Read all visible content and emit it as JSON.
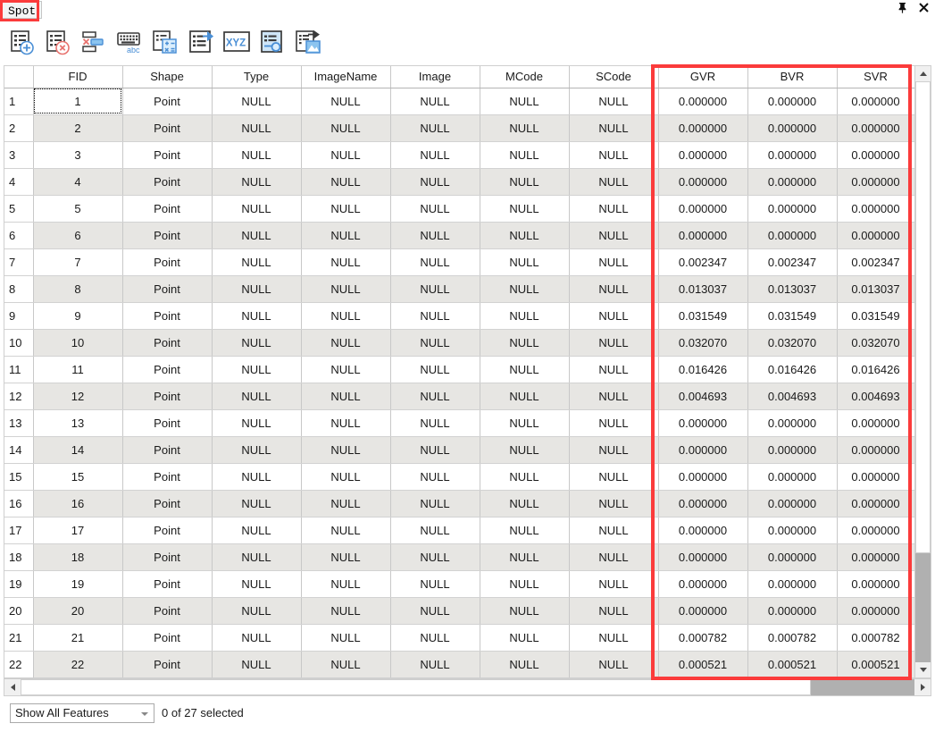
{
  "window": {
    "tab_label": "Spot",
    "pin_icon": "pin-icon",
    "close_icon": "close-icon",
    "pin_glyph": "丩",
    "close_glyph": "✕"
  },
  "toolbar": {
    "buttons": [
      {
        "name": "add-field-button",
        "tooltip": "Add Field"
      },
      {
        "name": "delete-field-button",
        "tooltip": "Delete Field"
      },
      {
        "name": "delete-selection-button",
        "tooltip": "Delete Selected Records"
      },
      {
        "name": "field-alias-button",
        "tooltip": "Field Alias"
      },
      {
        "name": "field-calculator-button",
        "tooltip": "Field Calculator"
      },
      {
        "name": "export-table-button",
        "tooltip": "Export Table"
      },
      {
        "name": "xyz-button",
        "tooltip": "XYZ"
      },
      {
        "name": "attribute-query-button",
        "tooltip": "Attribute Query"
      },
      {
        "name": "export-image-button",
        "tooltip": "Export Image"
      }
    ],
    "xyz_label": "XYZ",
    "abc_label": "abc"
  },
  "table": {
    "columns": [
      {
        "key": "rownum",
        "label": ""
      },
      {
        "key": "FID",
        "label": "FID"
      },
      {
        "key": "Shape",
        "label": "Shape"
      },
      {
        "key": "Type",
        "label": "Type"
      },
      {
        "key": "ImageName",
        "label": "ImageName"
      },
      {
        "key": "Image",
        "label": "Image"
      },
      {
        "key": "MCode",
        "label": "MCode"
      },
      {
        "key": "SCode",
        "label": "SCode"
      },
      {
        "key": "GVR",
        "label": "GVR"
      },
      {
        "key": "BVR",
        "label": "BVR"
      },
      {
        "key": "SVR",
        "label": "SVR"
      }
    ],
    "highlighted_columns": [
      "GVR",
      "BVR",
      "SVR"
    ],
    "highlight_color": "#fb3b3b",
    "focused_cell": {
      "row": 1,
      "column": "FID"
    },
    "rows": [
      {
        "rownum": "1",
        "FID": "1",
        "Shape": "Point",
        "Type": "NULL",
        "ImageName": "NULL",
        "Image": "NULL",
        "MCode": "NULL",
        "SCode": "NULL",
        "GVR": "0.000000",
        "BVR": "0.000000",
        "SVR": "0.000000"
      },
      {
        "rownum": "2",
        "FID": "2",
        "Shape": "Point",
        "Type": "NULL",
        "ImageName": "NULL",
        "Image": "NULL",
        "MCode": "NULL",
        "SCode": "NULL",
        "GVR": "0.000000",
        "BVR": "0.000000",
        "SVR": "0.000000"
      },
      {
        "rownum": "3",
        "FID": "3",
        "Shape": "Point",
        "Type": "NULL",
        "ImageName": "NULL",
        "Image": "NULL",
        "MCode": "NULL",
        "SCode": "NULL",
        "GVR": "0.000000",
        "BVR": "0.000000",
        "SVR": "0.000000"
      },
      {
        "rownum": "4",
        "FID": "4",
        "Shape": "Point",
        "Type": "NULL",
        "ImageName": "NULL",
        "Image": "NULL",
        "MCode": "NULL",
        "SCode": "NULL",
        "GVR": "0.000000",
        "BVR": "0.000000",
        "SVR": "0.000000"
      },
      {
        "rownum": "5",
        "FID": "5",
        "Shape": "Point",
        "Type": "NULL",
        "ImageName": "NULL",
        "Image": "NULL",
        "MCode": "NULL",
        "SCode": "NULL",
        "GVR": "0.000000",
        "BVR": "0.000000",
        "SVR": "0.000000"
      },
      {
        "rownum": "6",
        "FID": "6",
        "Shape": "Point",
        "Type": "NULL",
        "ImageName": "NULL",
        "Image": "NULL",
        "MCode": "NULL",
        "SCode": "NULL",
        "GVR": "0.000000",
        "BVR": "0.000000",
        "SVR": "0.000000"
      },
      {
        "rownum": "7",
        "FID": "7",
        "Shape": "Point",
        "Type": "NULL",
        "ImageName": "NULL",
        "Image": "NULL",
        "MCode": "NULL",
        "SCode": "NULL",
        "GVR": "0.002347",
        "BVR": "0.002347",
        "SVR": "0.002347"
      },
      {
        "rownum": "8",
        "FID": "8",
        "Shape": "Point",
        "Type": "NULL",
        "ImageName": "NULL",
        "Image": "NULL",
        "MCode": "NULL",
        "SCode": "NULL",
        "GVR": "0.013037",
        "BVR": "0.013037",
        "SVR": "0.013037"
      },
      {
        "rownum": "9",
        "FID": "9",
        "Shape": "Point",
        "Type": "NULL",
        "ImageName": "NULL",
        "Image": "NULL",
        "MCode": "NULL",
        "SCode": "NULL",
        "GVR": "0.031549",
        "BVR": "0.031549",
        "SVR": "0.031549"
      },
      {
        "rownum": "10",
        "FID": "10",
        "Shape": "Point",
        "Type": "NULL",
        "ImageName": "NULL",
        "Image": "NULL",
        "MCode": "NULL",
        "SCode": "NULL",
        "GVR": "0.032070",
        "BVR": "0.032070",
        "SVR": "0.032070"
      },
      {
        "rownum": "11",
        "FID": "11",
        "Shape": "Point",
        "Type": "NULL",
        "ImageName": "NULL",
        "Image": "NULL",
        "MCode": "NULL",
        "SCode": "NULL",
        "GVR": "0.016426",
        "BVR": "0.016426",
        "SVR": "0.016426"
      },
      {
        "rownum": "12",
        "FID": "12",
        "Shape": "Point",
        "Type": "NULL",
        "ImageName": "NULL",
        "Image": "NULL",
        "MCode": "NULL",
        "SCode": "NULL",
        "GVR": "0.004693",
        "BVR": "0.004693",
        "SVR": "0.004693"
      },
      {
        "rownum": "13",
        "FID": "13",
        "Shape": "Point",
        "Type": "NULL",
        "ImageName": "NULL",
        "Image": "NULL",
        "MCode": "NULL",
        "SCode": "NULL",
        "GVR": "0.000000",
        "BVR": "0.000000",
        "SVR": "0.000000"
      },
      {
        "rownum": "14",
        "FID": "14",
        "Shape": "Point",
        "Type": "NULL",
        "ImageName": "NULL",
        "Image": "NULL",
        "MCode": "NULL",
        "SCode": "NULL",
        "GVR": "0.000000",
        "BVR": "0.000000",
        "SVR": "0.000000"
      },
      {
        "rownum": "15",
        "FID": "15",
        "Shape": "Point",
        "Type": "NULL",
        "ImageName": "NULL",
        "Image": "NULL",
        "MCode": "NULL",
        "SCode": "NULL",
        "GVR": "0.000000",
        "BVR": "0.000000",
        "SVR": "0.000000"
      },
      {
        "rownum": "16",
        "FID": "16",
        "Shape": "Point",
        "Type": "NULL",
        "ImageName": "NULL",
        "Image": "NULL",
        "MCode": "NULL",
        "SCode": "NULL",
        "GVR": "0.000000",
        "BVR": "0.000000",
        "SVR": "0.000000"
      },
      {
        "rownum": "17",
        "FID": "17",
        "Shape": "Point",
        "Type": "NULL",
        "ImageName": "NULL",
        "Image": "NULL",
        "MCode": "NULL",
        "SCode": "NULL",
        "GVR": "0.000000",
        "BVR": "0.000000",
        "SVR": "0.000000"
      },
      {
        "rownum": "18",
        "FID": "18",
        "Shape": "Point",
        "Type": "NULL",
        "ImageName": "NULL",
        "Image": "NULL",
        "MCode": "NULL",
        "SCode": "NULL",
        "GVR": "0.000000",
        "BVR": "0.000000",
        "SVR": "0.000000"
      },
      {
        "rownum": "19",
        "FID": "19",
        "Shape": "Point",
        "Type": "NULL",
        "ImageName": "NULL",
        "Image": "NULL",
        "MCode": "NULL",
        "SCode": "NULL",
        "GVR": "0.000000",
        "BVR": "0.000000",
        "SVR": "0.000000"
      },
      {
        "rownum": "20",
        "FID": "20",
        "Shape": "Point",
        "Type": "NULL",
        "ImageName": "NULL",
        "Image": "NULL",
        "MCode": "NULL",
        "SCode": "NULL",
        "GVR": "0.000000",
        "BVR": "0.000000",
        "SVR": "0.000000"
      },
      {
        "rownum": "21",
        "FID": "21",
        "Shape": "Point",
        "Type": "NULL",
        "ImageName": "NULL",
        "Image": "NULL",
        "MCode": "NULL",
        "SCode": "NULL",
        "GVR": "0.000782",
        "BVR": "0.000782",
        "SVR": "0.000782"
      },
      {
        "rownum": "22",
        "FID": "22",
        "Shape": "Point",
        "Type": "NULL",
        "ImageName": "NULL",
        "Image": "NULL",
        "MCode": "NULL",
        "SCode": "NULL",
        "GVR": "0.000521",
        "BVR": "0.000521",
        "SVR": "0.000521"
      }
    ]
  },
  "statusbar": {
    "filter_value": "Show All Features",
    "selection_text": "0 of 27 selected"
  }
}
